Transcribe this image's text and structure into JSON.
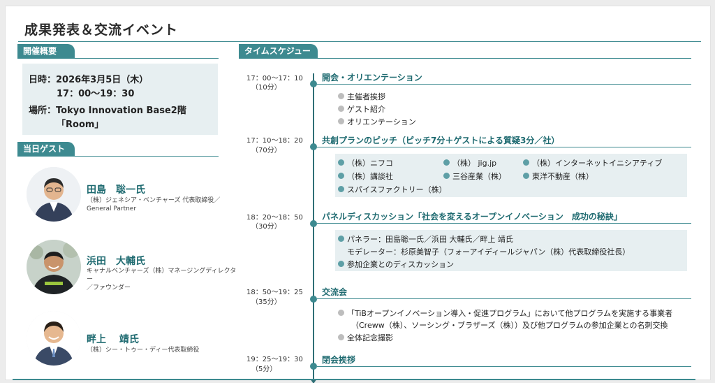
{
  "title": "成果発表＆交流イベント",
  "overview": {
    "tag": "開催概要",
    "date_line": "日時：2026年3月5日（木）",
    "time_line": "17：00〜19：30",
    "place_line": "場所：Tokyo Innovation Base2階",
    "room_line": "「Room」"
  },
  "guests": {
    "tag": "当日ゲスト",
    "list": [
      {
        "name": "田島　聡一氏",
        "desc": "（株）ジェネシア・ベンチャーズ 代表取締役／\nGeneral Partner"
      },
      {
        "name": "浜田　大輔氏",
        "desc": "キャナルベンチャーズ（株）マネージングディレクター\n／ファウンダー"
      },
      {
        "name": "畔上　 靖氏",
        "desc": "（株）シー・トゥー・ディー代表取締役"
      }
    ]
  },
  "timetable": {
    "tag": "タイムスケジュール",
    "sections": [
      {
        "time": "17：00〜17：10",
        "dur": "（10分）",
        "title": "開会・オリエンテーション",
        "items": [
          "主催者挨拶",
          "ゲスト紹介",
          "オリエンテーション"
        ]
      },
      {
        "time": "17：10〜18：20",
        "dur": "（70分）",
        "title": "共創プランのピッチ（ピッチ7分＋ゲストによる質疑3分／社）",
        "items": [
          "（株）ニフコ",
          "（株） jig.jp",
          "（株）インターネットイニシアティブ",
          "（株）講談社",
          "三谷産業（株）",
          "東洋不動産（株）",
          "スパイスファクトリー（株）"
        ]
      },
      {
        "time": "18：20〜18：50",
        "dur": "（30分）",
        "title": "パネルディスカッション「社会を変えるオープンイノベーション　成功の秘訣」",
        "items": [
          "パネラー：田島聡一氏／浜田 大輔氏／畔上 靖氏",
          "モデレーター：杉原美智子（フォーアイディールジャパン（株）代表取締役社長）",
          "参加企業とのディスカッション"
        ]
      },
      {
        "time": "18：50〜19：25",
        "dur": "（35分）",
        "title": "交流会",
        "items": [
          "「TiBオープンイノベーション導入・促進プログラム」において他プログラムを実施する事業者",
          "（Creww（株）、ソーシング・ブラザーズ（株））及び他プログラムの参加企業との名刺交換",
          "全体記念撮影"
        ]
      },
      {
        "time": "19：25〜19：30",
        "dur": "（5分）",
        "title": "閉会挨拶",
        "items": []
      }
    ]
  }
}
